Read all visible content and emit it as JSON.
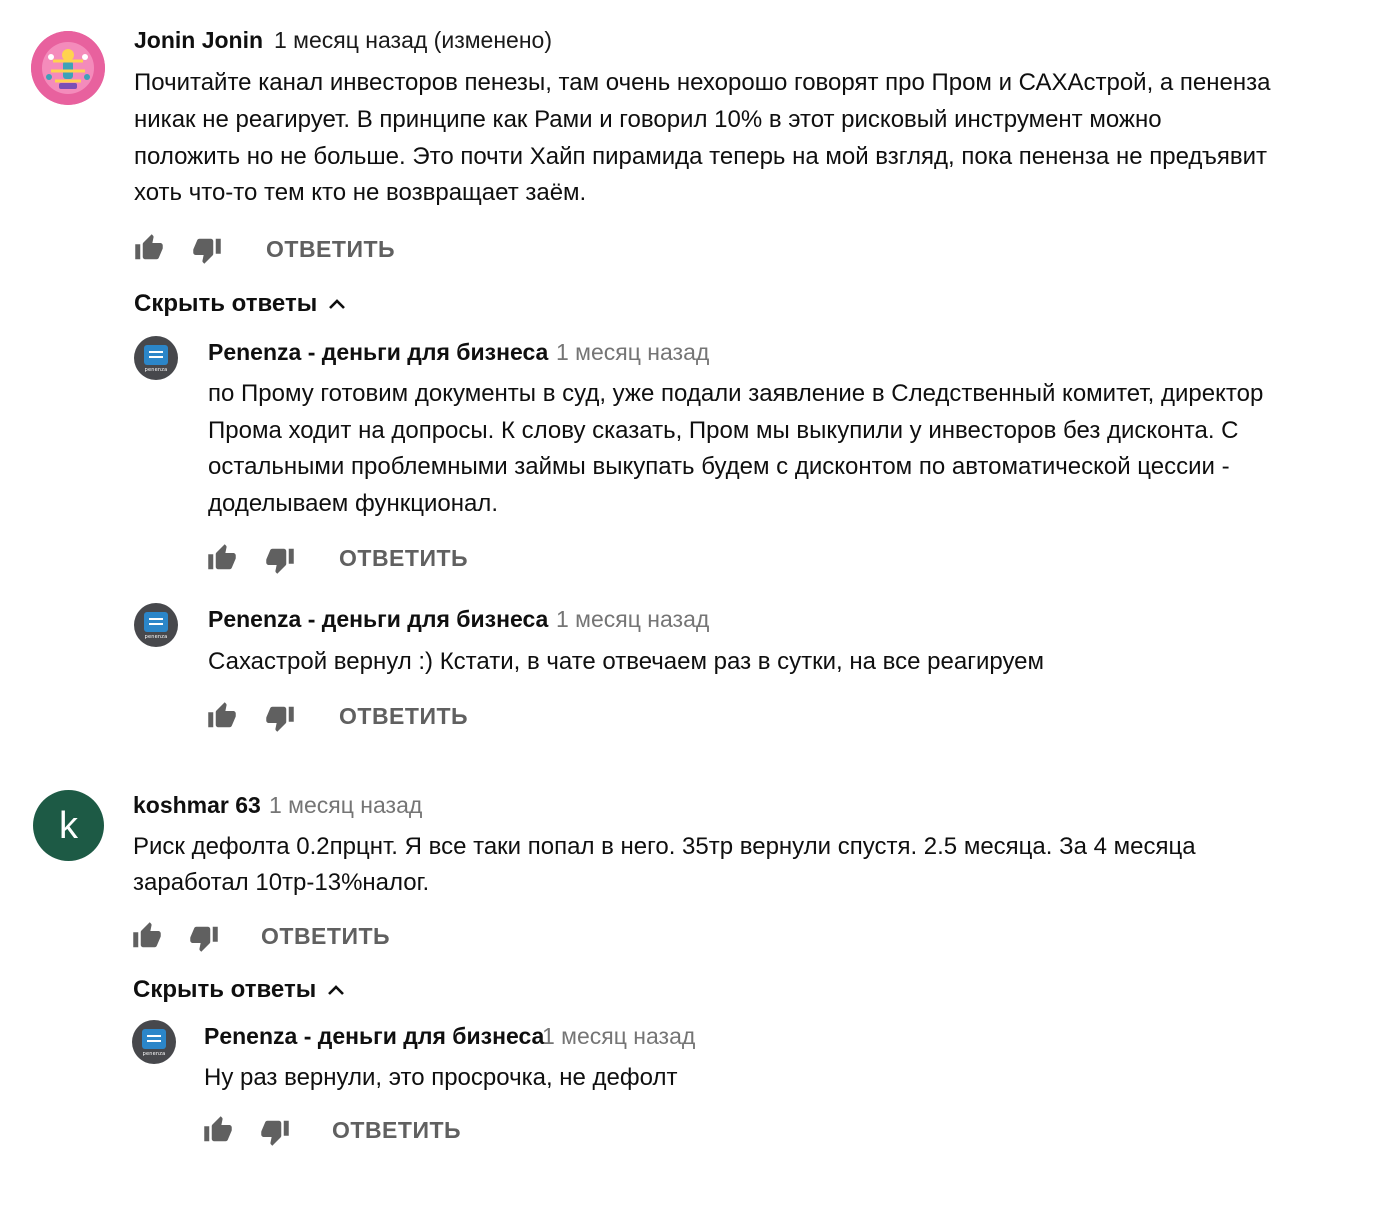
{
  "comments": [
    {
      "author": "Jonin Jonin",
      "time": "1 месяц назад (изменено)",
      "lines": [
        "Почитайте канал инвесторов пенезы, там очень нехорошо говорят про Пром и САХАстрой, а пененза",
        "никак не реагирует. В принципе как Рами и говорил 10% в этот рисковый инструмент можно",
        "положить но не больше. Это почти Хайп пирамида теперь на мой взгляд, пока пененза не предъявит",
        "хоть что-то тем кто не возвращает заём."
      ],
      "reply_label": "ОТВЕТИТЬ",
      "toggle_label": "Скрыть ответы",
      "replies": [
        {
          "author": "Penenza - деньги для бизнеса",
          "time": "1 месяц назад",
          "lines": [
            "по Прому готовим документы в суд, уже подали заявление в Следственный комитет, директор",
            "Прома ходит на допросы. К слову сказать, Пром мы выкупили у инвесторов без дисконта. С",
            "остальными проблемными займы выкупать будем с дисконтом по автоматической цессии -",
            "доделываем функционал."
          ],
          "reply_label": "ОТВЕТИТЬ"
        },
        {
          "author": "Penenza - деньги для бизнеса",
          "time": "1 месяц назад",
          "lines": [
            "Сахастрой вернул :) Кстати, в чате отвечаем раз в сутки, на все реагируем"
          ],
          "reply_label": "ОТВЕТИТЬ"
        }
      ]
    },
    {
      "author": "koshmar 63",
      "avatar_letter": "k",
      "time": "1 месяц назад",
      "lines": [
        "Риск дефолта 0.2прцнт. Я все таки попал в него. 35тр вернули спустя. 2.5 месяца. За 4 месяца",
        "заработал 10тр-13%налог."
      ],
      "reply_label": "ОТВЕТИТЬ",
      "toggle_label": "Скрыть ответы",
      "replies": [
        {
          "author": "Penenza - деньги для бизнеса",
          "time": "1 месяц назад",
          "lines": [
            "Ну раз вернули, это просрочка, не дефолт"
          ],
          "reply_label": "ОТВЕТИТЬ"
        }
      ]
    }
  ],
  "avatar_logo_text": "penenza",
  "colors": {
    "text": "#0f0f0f",
    "meta": "#757575",
    "action": "#606060",
    "avatar_k": "#1d5a45",
    "avatar_penenza": "#47484c",
    "penenza_blue": "#2b86c9",
    "avatar_pink": "#e8619e"
  },
  "icons": [
    "thumb-up-icon",
    "thumb-down-icon",
    "chevron-up-icon"
  ]
}
